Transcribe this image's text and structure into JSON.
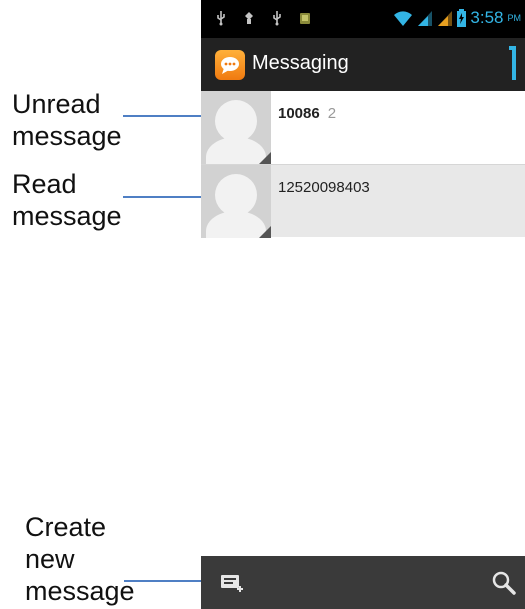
{
  "annotations": {
    "unread": "Unread\nmessage",
    "read": "Read\nmessage",
    "create": "Create\nnew\nmessage"
  },
  "status_bar": {
    "time": "3:58",
    "ampm": "PM",
    "accent_color": "#33b5e5"
  },
  "action_bar": {
    "title": "Messaging",
    "app_icon": "messaging-app-icon",
    "app_icon_color": "#f59a23"
  },
  "threads": [
    {
      "sender": "10086",
      "count": "2",
      "state": "unread"
    },
    {
      "sender": "12520098403",
      "count": "",
      "state": "read"
    }
  ],
  "bottom_bar": {
    "compose_icon": "compose-new-message-icon",
    "search_icon": "search-icon"
  }
}
